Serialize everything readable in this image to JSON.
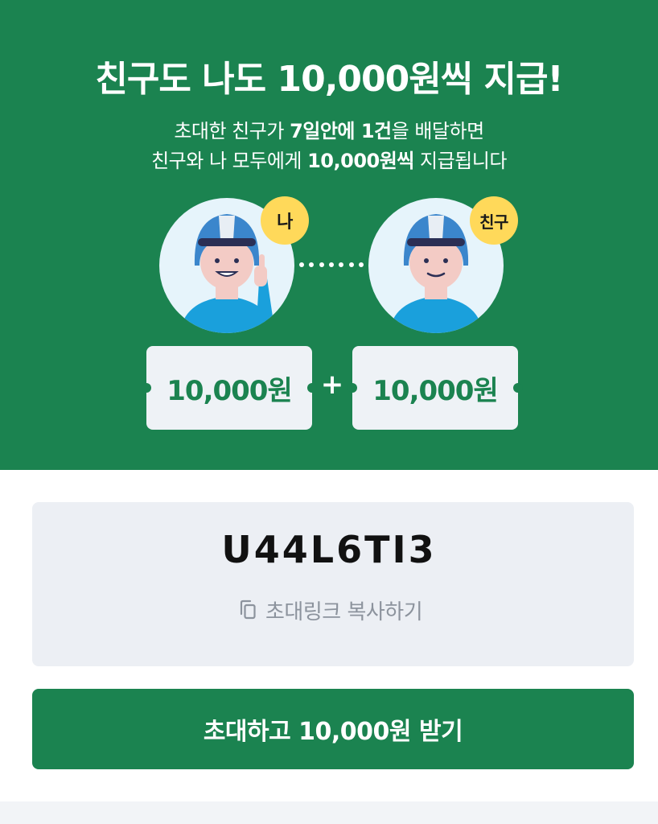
{
  "hero": {
    "title": "친구도 나도 10,000원씩 지급!",
    "line1": {
      "pre": "초대한 친구가 ",
      "bold1": "7일안에 1건",
      "post": "을 배달하면"
    },
    "line2": {
      "pre": "친구와 나 모두에게 ",
      "bold": "10,000원씩",
      "post": " 지급됩니다"
    },
    "me_badge": "나",
    "friend_badge": "친구",
    "my_reward": "10,000원",
    "plus": "+",
    "friend_reward": "10,000원"
  },
  "invite": {
    "code": "U44L6TI3",
    "copy_label": "초대링크 복사하기"
  },
  "cta": {
    "label": "초대하고 10,000원 받기"
  },
  "colors": {
    "brand_green": "#1b8350",
    "badge_yellow": "#ffd95a",
    "ticket_bg": "#eef2f6"
  }
}
